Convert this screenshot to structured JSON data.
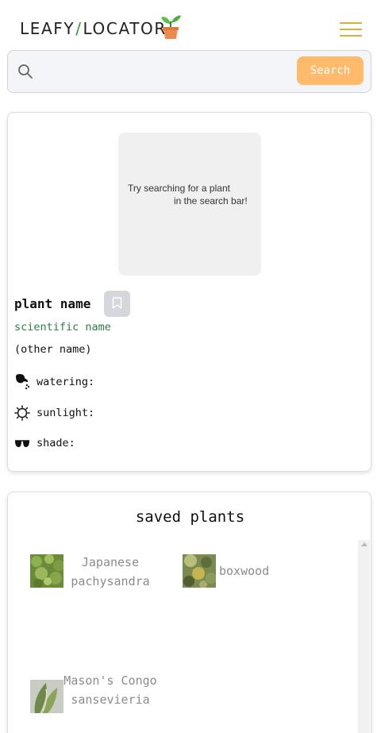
{
  "header": {
    "logo_left": "LEAFY",
    "logo_slash": "/",
    "logo_right": "LOCATOR"
  },
  "search": {
    "placeholder": "",
    "value": "",
    "button_label": "Search"
  },
  "plant_card": {
    "placeholder_line1": "Try searching for a plant",
    "placeholder_line2": "in the search bar!",
    "plant_name": "plant name",
    "scientific_name": "scientific name",
    "other_name": "(other name)",
    "watering_label": "watering:",
    "sunlight_label": "sunlight:",
    "shade_label": "shade:"
  },
  "saved": {
    "title": "saved plants",
    "items": [
      {
        "name": "Japanese pachysandra"
      },
      {
        "name": "boxwood"
      },
      {
        "name": "Mason's Congo sansevieria"
      }
    ]
  },
  "colors": {
    "accent_button": "#ffba6b",
    "logo_slash": "#2e9e3a",
    "scientific_name": "#2f7d4a",
    "hamburger": "#d9b23c"
  }
}
